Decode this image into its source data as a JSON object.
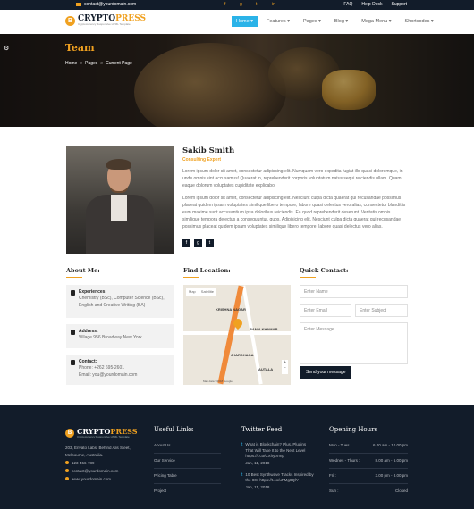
{
  "topbar": {
    "email": "contact@yourdomain.com",
    "links": [
      "FAQ",
      "Help Desk",
      "Support"
    ]
  },
  "header": {
    "brand_a": "CRYPTO",
    "brand_b": "PRESS",
    "tagline": "Cryptocurrency Responsive HTML Template",
    "nav": [
      {
        "label": "Home",
        "active": true
      },
      {
        "label": "Features"
      },
      {
        "label": "Pages"
      },
      {
        "label": "Blog"
      },
      {
        "label": "Mega Menu"
      },
      {
        "label": "Shortcodes"
      }
    ]
  },
  "hero": {
    "title": "Team",
    "breadcrumb": [
      "Home",
      "Pages",
      "Current Page"
    ]
  },
  "profile": {
    "name": "Sakib Smith",
    "role": "Consulting Expert",
    "p1": "Lorem ipsum dolor sit amet, consectetur adipiscing elit. Numquam vero expedita fugiat illo quasi doloremque, in unde omnis sint accusamus! Quaerat in, reprehenderit corporis voluptatum natus sequi reiciendis ullam. Quam eaque dolorum voluptates cupiditate explicabo.",
    "p2": "Lorem ipsum dolor sit amet, consectetur adipiscing elit. Nesciunt culpa dicta quaerat qui recusandae possimus placeat quidem ipsam voluptates similique libero tempore, labore quasi delectus vero alias, consectetur blanditiis eum maxime sunt accusantium ipsa doloribus reiciendis. Ea quod reprehenderit deserunt. Veritatis omnis similique tempora delectus a consequuntur, quos. Adipisicing elit. Nesciunt culpa dicta quaerat qui recusandae possimus placeat quidem ipsam voluptates similique libero tempore, labore quasi delectus vero alias."
  },
  "about": {
    "title": "About Me:",
    "exp_label": "Experiences:",
    "exp_value": "Chemistry (BSc), Computer Science (BSc), English and Creative Writing (BA)",
    "addr_label": "Address:",
    "addr_value": "Village 956 Broadway New York",
    "contact_label": "Contact:",
    "contact_phone": "Phone: +262 695-2601",
    "contact_email": "Email: you@yourdomain.com"
  },
  "location": {
    "title": "Find Location:",
    "tab_map": "Map",
    "tab_sat": "Satellite",
    "l1": "KRISHNA NAGAR",
    "l2": "BANIA KHAMAR",
    "l3": "JHARDHAGA",
    "l4": "AUTALA",
    "credit": "Map data ©2018 Google"
  },
  "quick": {
    "title": "Quick Contact:",
    "name_ph": "Enter Name",
    "email_ph": "Enter Email",
    "subject_ph": "Enter Subject",
    "message_ph": "Enter Message",
    "send": "Send your message"
  },
  "footer": {
    "address": "203, Envato Labs, Behind Alis Steet, Melbourne, Australia.",
    "phone": "123-456-789",
    "email": "contact@yourdomain.com",
    "web": "www.yourdomain.com",
    "useful_title": "Useful Links",
    "useful": [
      "About Us",
      "Our Service",
      "Pricing Table",
      "Project"
    ],
    "twitter_title": "Twitter Feed",
    "tw1": "What is Blockchain? Plus, Plugins That Will Take It to the Next Level https://t.co/CXhytVmp",
    "tw1_date": "Jan, 11, 2018",
    "tw2": "10 Best Synthwave Tracks Inspired by the 80s https://t.co/uFMg8QlY",
    "tw2_date": "Jan, 11, 2018",
    "hours_title": "Opening Hours",
    "hours": [
      {
        "day": "Mon - Tues :",
        "time": "6.00 am - 10.00 pm"
      },
      {
        "day": "Wednes - Thurs :",
        "time": "8.00 am - 6.00 pm"
      },
      {
        "day": "Fri :",
        "time": "3.00 pm - 8.00 pm"
      },
      {
        "day": "Sun :",
        "time": "Closed"
      }
    ]
  }
}
